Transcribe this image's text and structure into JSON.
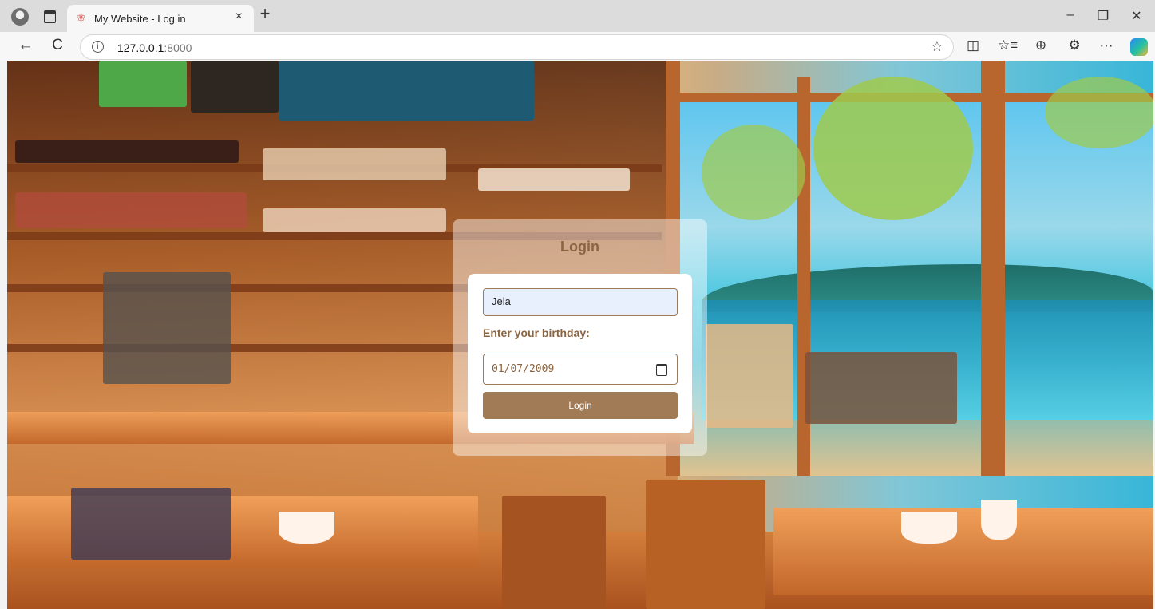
{
  "browser": {
    "tab": {
      "title": "My Website - Log in",
      "close": "×"
    },
    "new_tab": "+",
    "window": {
      "minimize": "–",
      "restore": "❐",
      "close": "✕"
    },
    "nav": {
      "back": "←",
      "reload": "C"
    },
    "address": {
      "info": "i",
      "host": "127.0.0.1",
      "port": ":8000",
      "favorite": "☆"
    },
    "toolbar": {
      "split": "◫",
      "favorites": "☆≡",
      "collections": "⊕",
      "extensions": "⚙",
      "more": "···"
    }
  },
  "login": {
    "title": "Login",
    "username_value": "Jela",
    "birthday_label": "Enter your birthday:",
    "birthday_value": "01/07/2009",
    "submit_label": "Login"
  }
}
